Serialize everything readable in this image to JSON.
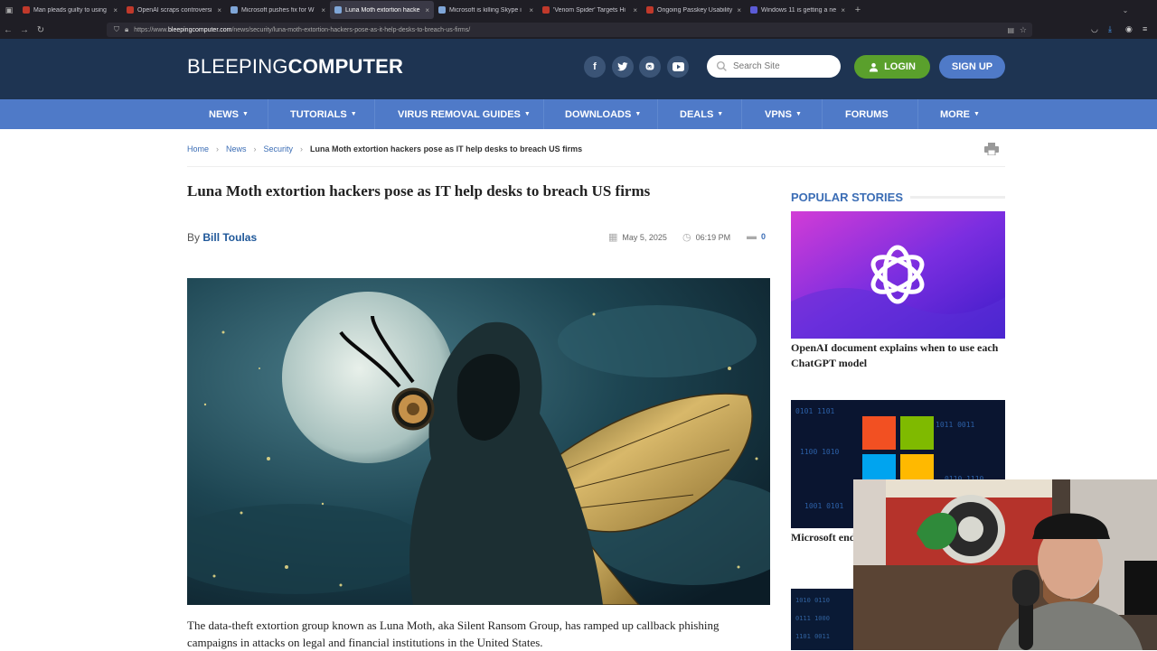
{
  "browser": {
    "tabs": [
      {
        "label": "Man pleads guilty to using",
        "color": "#c0392b"
      },
      {
        "label": "OpenAI scraps controversi",
        "color": "#c0392b"
      },
      {
        "label": "Microsoft pushes fix for W",
        "color": "#7fa6d8"
      },
      {
        "label": "Luna Moth extortion hacke",
        "color": "#7fa6d8"
      },
      {
        "label": "Microsoft is killing Skype i",
        "color": "#7fa6d8"
      },
      {
        "label": "'Venom Spider' Targets Hi",
        "color": "#c0392b"
      },
      {
        "label": "Ongoing Passkey Usability",
        "color": "#c0392b"
      },
      {
        "label": "Windows 11 is getting a ne",
        "color": "#5b5bd6"
      }
    ],
    "url_prefix": "https://www.",
    "url_host": "bleepingcomputer.com",
    "url_path": "/news/security/luna-moth-extortion-hackers-pose-as-it-help-desks-to-breach-us-firms/"
  },
  "header": {
    "logo_left": "BLEEPING",
    "logo_right": "COMPUTER",
    "search_placeholder": "Search Site",
    "login_label": "LOGIN",
    "signup_label": "SIGN UP"
  },
  "nav": {
    "items": [
      "NEWS",
      "TUTORIALS",
      "VIRUS REMOVAL GUIDES",
      "DOWNLOADS",
      "DEALS",
      "VPNS",
      "FORUMS",
      "MORE"
    ]
  },
  "breadcrumb": {
    "home": "Home",
    "news": "News",
    "security": "Security",
    "current": "Luna Moth extortion hackers pose as IT help desks to breach US firms"
  },
  "article": {
    "title": "Luna Moth extortion hackers pose as IT help desks to breach US firms",
    "by": "By",
    "author": "Bill Toulas",
    "date": "May 5, 2025",
    "time": "06:19 PM",
    "comments": "0",
    "lead": "The data-theft extortion group known as Luna Moth, aka Silent Ransom Group, has ramped up callback phishing campaigns in attacks on legal and financial institutions in the United States."
  },
  "sidebar": {
    "heading": "POPULAR STORIES",
    "stories": [
      {
        "title": "OpenAI document explains when to use each ChatGPT model"
      },
      {
        "title": "Microsoft end autofill, move"
      }
    ]
  },
  "colors": {
    "header_bg": "#1e3452",
    "nav_bg": "#4f7ac8",
    "login_green": "#5aa02c",
    "link_blue": "#3b6db5"
  }
}
